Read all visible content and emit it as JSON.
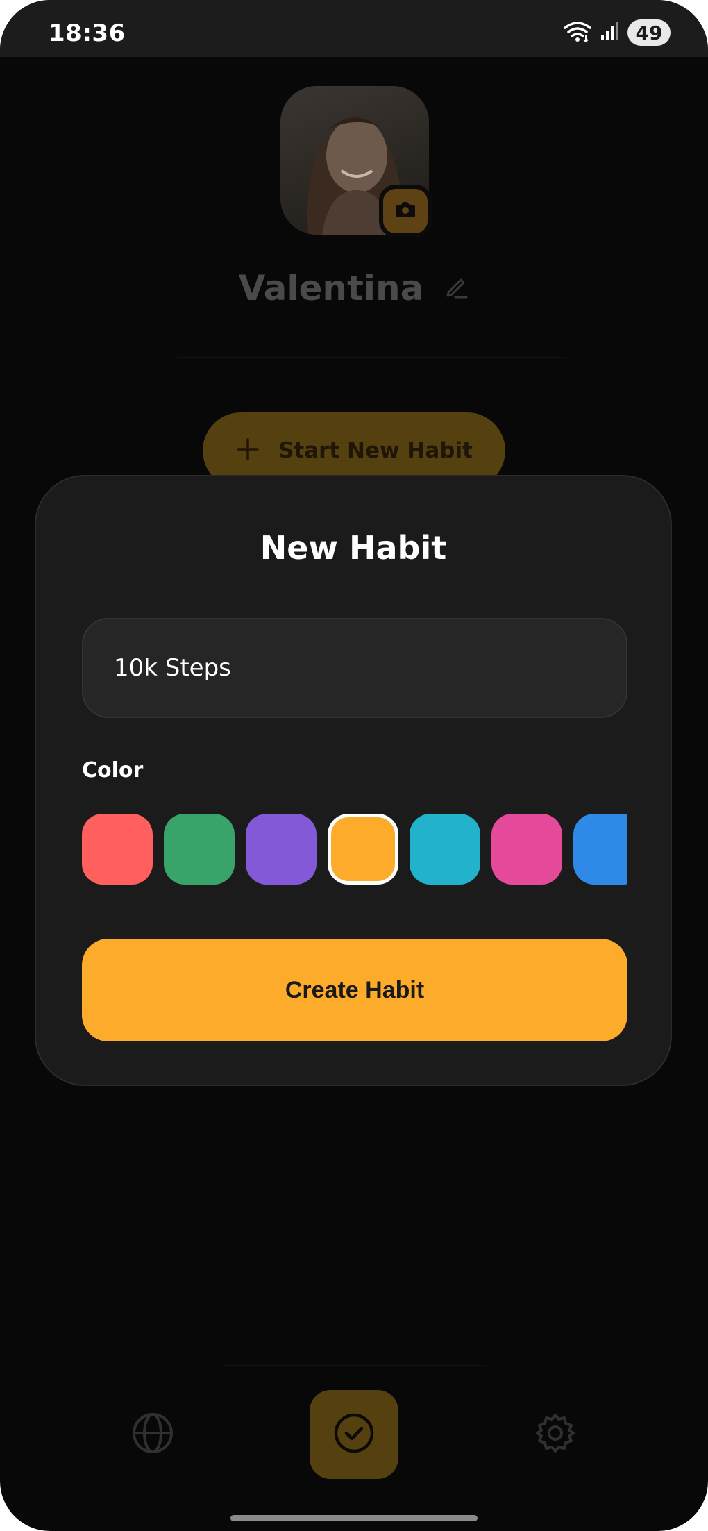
{
  "status_bar": {
    "time": "18:36",
    "battery": "49"
  },
  "profile": {
    "name": "Valentina"
  },
  "background": {
    "start_button_label": "Start New Habit"
  },
  "modal": {
    "title": "New Habit",
    "input_value": "10k Steps",
    "color_label": "Color",
    "colors": [
      "#ff605e",
      "#38a46a",
      "#8459d8",
      "#fdab2b",
      "#22b2cc",
      "#e64a9a",
      "#2f89e6"
    ],
    "selected_color": "#fdab2b",
    "create_button_label": "Create Habit"
  },
  "nav": {
    "left_icon": "globe-icon",
    "center_icon": "check-circle-icon",
    "right_icon": "gear-icon"
  }
}
